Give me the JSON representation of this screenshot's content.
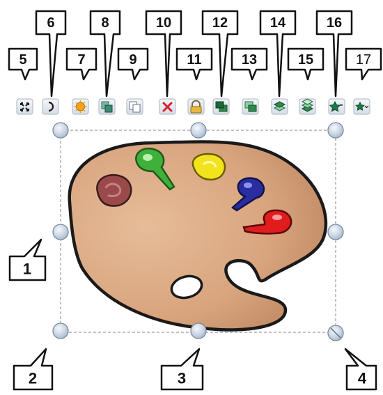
{
  "toolbar": {
    "buttons": [
      {
        "number": "5",
        "name": "fullscreen-icon"
      },
      {
        "number": "6",
        "name": "rotate-icon"
      },
      {
        "number": "7",
        "name": "sun-effect-icon"
      },
      {
        "number": "8",
        "name": "clone-icon"
      },
      {
        "number": "9",
        "name": "copy-icon"
      },
      {
        "number": "10",
        "name": "delete-icon"
      },
      {
        "number": "11",
        "name": "lock-icon"
      },
      {
        "number": "12",
        "name": "bring-to-front-icon"
      },
      {
        "number": "13",
        "name": "send-to-back-icon"
      },
      {
        "number": "14",
        "name": "bring-forward-icon"
      },
      {
        "number": "15",
        "name": "send-backward-icon"
      },
      {
        "number": "16",
        "name": "favorite-add-icon"
      },
      {
        "number": "17",
        "name": "favorite-menu-icon"
      }
    ]
  },
  "handles": [
    {
      "number": "1",
      "name": "middle-left-handle"
    },
    {
      "number": "2",
      "name": "bottom-left-handle"
    },
    {
      "number": "3",
      "name": "bottom-center-handle"
    },
    {
      "number": "4",
      "name": "resize-handle"
    }
  ],
  "colors": {
    "palette_fill": "#d8a47e",
    "palette_shade": "#c58f69",
    "outline": "#1a1a1a",
    "frame": "#9a9a9a",
    "toolbar_button": "#dfe6ee",
    "handle": "#c9d5e4"
  }
}
